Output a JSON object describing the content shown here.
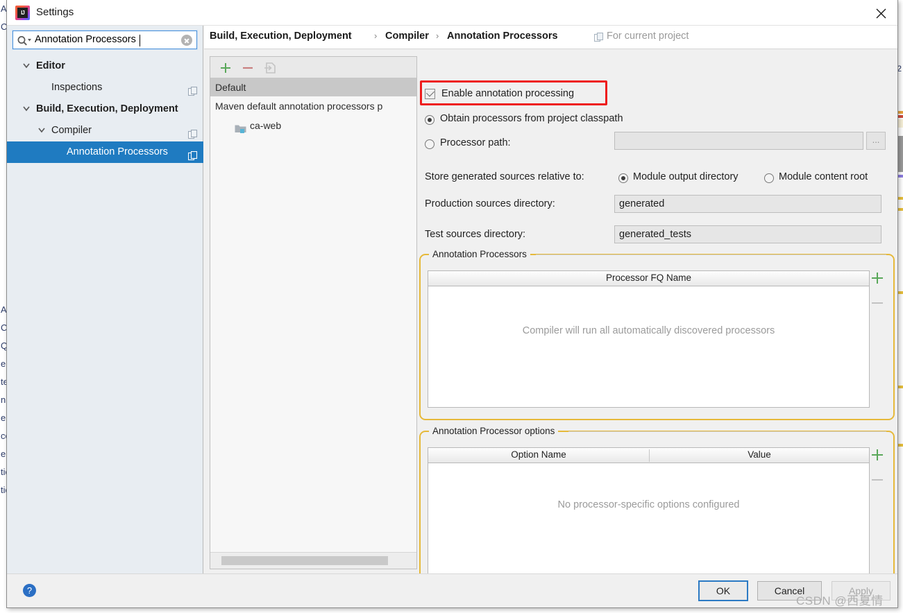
{
  "window": {
    "title": "Settings",
    "app_icon": "intellij-idea-icon",
    "close_icon": "close-icon"
  },
  "search": {
    "value": "Annotation Processors",
    "placeholder": "Search settings",
    "icon": "search-icon",
    "clear_icon": "clear-icon"
  },
  "sidebar": {
    "items": [
      {
        "label": "Editor",
        "level": 0,
        "bold": true,
        "expanded": true,
        "selected": false,
        "has_copy_icon": false
      },
      {
        "label": "Inspections",
        "level": 1,
        "bold": false,
        "expanded": null,
        "selected": false,
        "has_copy_icon": true
      },
      {
        "label": "Build, Execution, Deployment",
        "level": 0,
        "bold": true,
        "expanded": true,
        "selected": false,
        "has_copy_icon": false
      },
      {
        "label": "Compiler",
        "level": 1,
        "bold": false,
        "expanded": true,
        "selected": false,
        "has_copy_icon": true
      },
      {
        "label": "Annotation Processors",
        "level": 2,
        "bold": false,
        "expanded": null,
        "selected": true,
        "has_copy_icon": true
      }
    ]
  },
  "breadcrumb": {
    "segments": [
      "Build, Execution, Deployment",
      "Compiler",
      "Annotation Processors"
    ],
    "separator": "›",
    "scope_label": "For current project",
    "scope_icon": "copy-scope-icon"
  },
  "module_panel": {
    "toolbar": {
      "add_icon": "plus-icon",
      "remove_icon": "minus-icon",
      "copy_to_icon": "copy-to-module-icon"
    },
    "header": "Default",
    "rows": [
      {
        "label": "Maven default annotation processors p",
        "indent": false,
        "icon": null
      },
      {
        "label": "ca-web",
        "indent": true,
        "icon": "module-folder-icon"
      }
    ]
  },
  "settings": {
    "enable_checkbox": {
      "label": "Enable annotation processing",
      "checked": true,
      "highlight_color": "#ee1c1c"
    },
    "source_radio": {
      "options": [
        "Obtain processors from project classpath",
        "Processor path:"
      ],
      "selected_index": 0
    },
    "processor_path": {
      "value": "",
      "browse_label": "..."
    },
    "store_relative": {
      "label": "Store generated sources relative to:",
      "options": [
        "Module output directory",
        "Module content root"
      ],
      "selected_index": 0
    },
    "production_sources": {
      "label": "Production sources directory:",
      "value": "generated"
    },
    "test_sources": {
      "label": "Test sources directory:",
      "value": "generated_tests"
    }
  },
  "processors_group": {
    "title": "Annotation Processors",
    "columns": [
      "Processor FQ Name"
    ],
    "rows": [],
    "empty_text": "Compiler will run all automatically discovered processors",
    "add_icon": "plus-icon",
    "remove_icon": "minus-icon"
  },
  "options_group": {
    "title": "Annotation Processor options",
    "columns": [
      "Option Name",
      "Value"
    ],
    "rows": [],
    "empty_text": "No processor-specific options configured",
    "add_icon": "plus-icon",
    "remove_icon": "minus-icon"
  },
  "footer": {
    "help_label": "?",
    "ok_label": "OK",
    "cancel_label": "Cancel",
    "apply_label": "Apply",
    "apply_enabled": false
  },
  "watermark": "CSDN @西夏情",
  "background": {
    "left_fragments": [
      "Ac",
      "Co",
      "Qu",
      "e",
      "te",
      "nS",
      "en",
      "co",
      "el",
      "tic",
      "tic"
    ],
    "minimap_number": "2",
    "error_badge": "!"
  },
  "colors": {
    "selection": "#1f7bc1",
    "highlight_red": "#ee1c1c",
    "group_border": "#e6b93a",
    "accent_blue": "#2b7ac4"
  }
}
